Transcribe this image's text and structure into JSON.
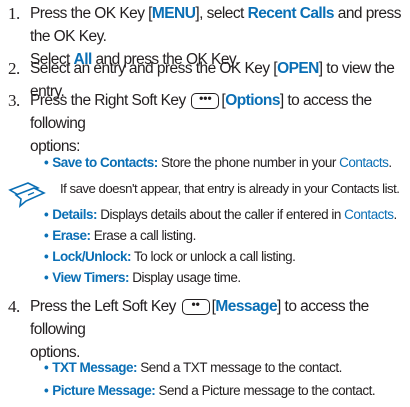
{
  "steps": [
    {
      "number": "1.",
      "parts": [
        "Press the OK Key [",
        "MENU",
        "], select ",
        "Recent Calls",
        " and press the OK Key.",
        "Select ",
        "All",
        " and press the OK Key."
      ]
    },
    {
      "number": "2.",
      "parts": [
        "Select an entry and press the OK Key [",
        "OPEN",
        "] to view the entry."
      ]
    },
    {
      "number": "3.",
      "parts": [
        "Press the Right Soft Key ",
        "[",
        "Options",
        "] to access the following",
        "options:"
      ]
    },
    {
      "number": "4.",
      "parts": [
        "Press the Left Soft Key ",
        "[",
        "Message",
        "] to access the following",
        "options."
      ]
    }
  ],
  "options_list": [
    {
      "term": "Save to Contacts:",
      "text": " Store the phone number in your ",
      "link": "Contacts",
      "tail": "."
    },
    {
      "term": "Details:",
      "text": " Displays details about the caller if entered in ",
      "link": "Contacts",
      "tail": "."
    },
    {
      "term": "Erase:",
      "text": " Erase a call listing.",
      "link": "",
      "tail": ""
    },
    {
      "term": "Lock/Unlock:",
      "text": " To lock or unlock a call listing.",
      "link": "",
      "tail": ""
    },
    {
      "term": "View Timers:",
      "text": " Display usage time.",
      "link": "",
      "tail": ""
    }
  ],
  "note": {
    "text": "If save doesn't appear, that entry is already in your Contacts list.",
    "icon": "note-icon"
  },
  "message_list": [
    {
      "term": "TXT Message:",
      "text": " Send a TXT message to the contact."
    },
    {
      "term": "Picture Message:",
      "text": " Send a Picture message to the contact."
    }
  ],
  "bullet": "•",
  "key_glyph": "•••",
  "key_glyph_left": "••",
  "colors": {
    "accent": "#0a6fb5",
    "text": "#231f20"
  }
}
